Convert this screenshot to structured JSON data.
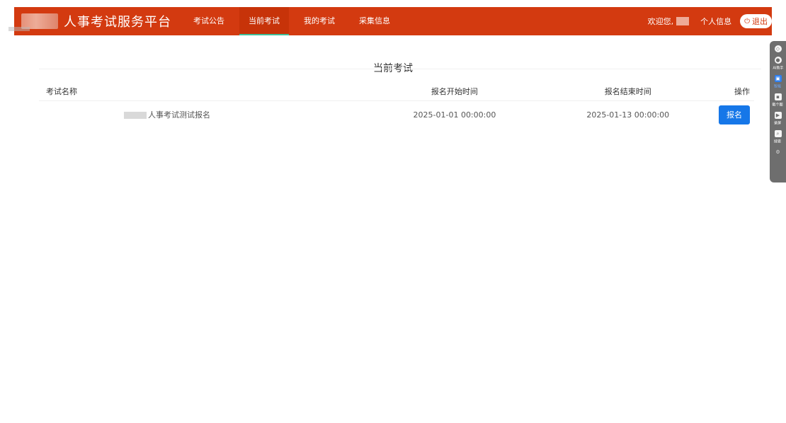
{
  "header": {
    "title": "人事考试服务平台",
    "nav": [
      {
        "label": "考试公告",
        "active": false
      },
      {
        "label": "当前考试",
        "active": true
      },
      {
        "label": "我的考试",
        "active": false
      },
      {
        "label": "采集信息",
        "active": false
      }
    ],
    "welcome": "欢迎您,",
    "profile_label": "个人信息",
    "logout_label": "退出",
    "brand_color": "#d33a10"
  },
  "main": {
    "section_title": "当前考试",
    "columns": {
      "name": "考试名称",
      "start": "报名开始时间",
      "end": "报名结束时间",
      "op": "操作"
    },
    "rows": [
      {
        "name": "人事考试测试报名",
        "start": "2025-01-01 00:00:00",
        "end": "2025-01-13 00:00:00",
        "action": "报名"
      }
    ]
  },
  "side_tool": {
    "items": [
      {
        "icon": "shield-icon",
        "label": ""
      },
      {
        "icon": "ai-icon",
        "label": "AI助手"
      },
      {
        "icon": "page-icon",
        "label": "智能"
      },
      {
        "icon": "screenshot-icon",
        "label": "截个图"
      },
      {
        "icon": "record-icon",
        "label": "录屏"
      },
      {
        "icon": "search-icon",
        "label": "搜索"
      },
      {
        "icon": "settings-icon",
        "label": ""
      }
    ]
  }
}
